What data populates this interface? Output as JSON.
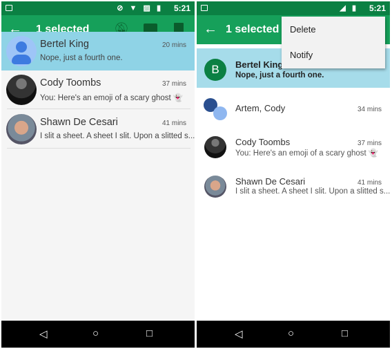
{
  "status": {
    "time": "5:21"
  },
  "left": {
    "toolbar": {
      "title": "1 selected",
      "back": "←",
      "icons": [
        "mute-icon",
        "archive-icon",
        "delete-icon"
      ]
    },
    "conversations": [
      {
        "name": "Bertel King",
        "snippet": "Nope, just a fourth one.",
        "time": "20 mins",
        "selected": true
      },
      {
        "name": "Cody Toombs",
        "snippet": "You: Here's an emoji of a scary ghost 👻",
        "time": "37 mins"
      },
      {
        "name": "Shawn De Cesari",
        "snippet": "I slit a sheet. A sheet I slit. Upon a slitted s...",
        "time": "41 mins"
      }
    ]
  },
  "right": {
    "toolbar": {
      "title": "1 selected",
      "back": "←"
    },
    "menu": [
      "Delete",
      "Notify"
    ],
    "selected": {
      "initial": "B",
      "name": "Bertel King",
      "snippet": "Nope, just a fourth one."
    },
    "conversations": [
      {
        "name": "Artem, Cody",
        "snippet": "",
        "time": "34 mins"
      },
      {
        "name": "Cody Toombs",
        "snippet": "You: Here's an emoji of a scary ghost 👻",
        "time": "37 mins"
      },
      {
        "name": "Shawn De Cesari",
        "snippet": "I slit a sheet. A sheet I slit. Upon a slitted s...",
        "time": "41 mins"
      }
    ]
  },
  "nav": {
    "back": "◁",
    "home": "○",
    "recents": "□"
  },
  "colors": {
    "status": "#0b8043",
    "toolbar": "#16a05a",
    "selected_row": "#8fd3e6",
    "avatar_b": "#0b8043"
  }
}
